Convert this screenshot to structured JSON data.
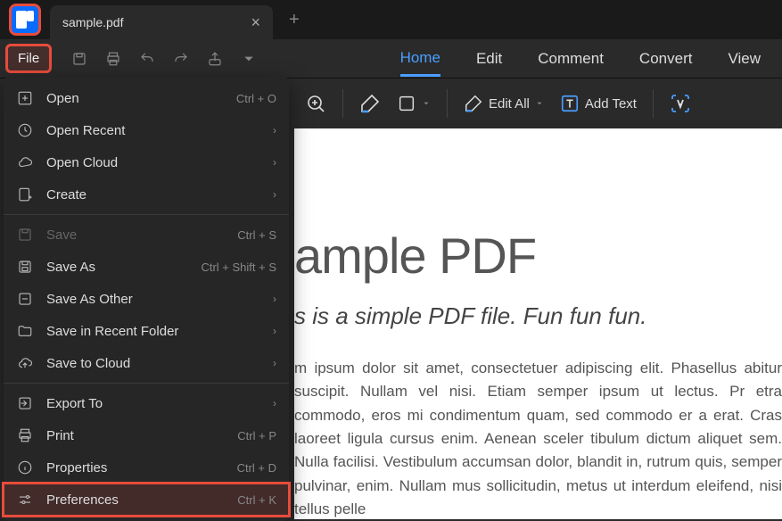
{
  "titlebar": {
    "tab_title": "sample.pdf"
  },
  "toolbar": {
    "file_label": "File"
  },
  "topnav": {
    "home": "Home",
    "edit": "Edit",
    "comment": "Comment",
    "convert": "Convert",
    "view": "View"
  },
  "secondbar": {
    "edit_all": "Edit All",
    "add_text": "Add Text"
  },
  "file_menu": {
    "open": {
      "label": "Open",
      "sc": "Ctrl + O"
    },
    "open_recent": {
      "label": "Open Recent"
    },
    "open_cloud": {
      "label": "Open Cloud"
    },
    "create": {
      "label": "Create"
    },
    "save": {
      "label": "Save",
      "sc": "Ctrl + S"
    },
    "save_as": {
      "label": "Save As",
      "sc": "Ctrl + Shift + S"
    },
    "save_as_other": {
      "label": "Save As Other"
    },
    "save_recent_folder": {
      "label": "Save in Recent Folder"
    },
    "save_to_cloud": {
      "label": "Save to Cloud"
    },
    "export_to": {
      "label": "Export To"
    },
    "print": {
      "label": "Print",
      "sc": "Ctrl + P"
    },
    "properties": {
      "label": "Properties",
      "sc": "Ctrl + D"
    },
    "preferences": {
      "label": "Preferences",
      "sc": "Ctrl + K"
    }
  },
  "document": {
    "heading": "ample PDF",
    "subheading": "s is a simple PDF file. Fun fun fun.",
    "body": "m ipsum dolor sit amet, consectetuer adipiscing elit. Phasellus abitur suscipit. Nullam vel nisi. Etiam semper ipsum ut lectus. Pr etra commodo, eros mi condimentum quam, sed commodo er a erat. Cras laoreet ligula cursus enim. Aenean sceler tibulum dictum aliquet sem. Nulla facilisi. Vestibulum accumsan dolor, blandit in, rutrum quis, semper pulvinar, enim. Nullam mus sollicitudin, metus ut interdum eleifend, nisi tellus pelle"
  }
}
